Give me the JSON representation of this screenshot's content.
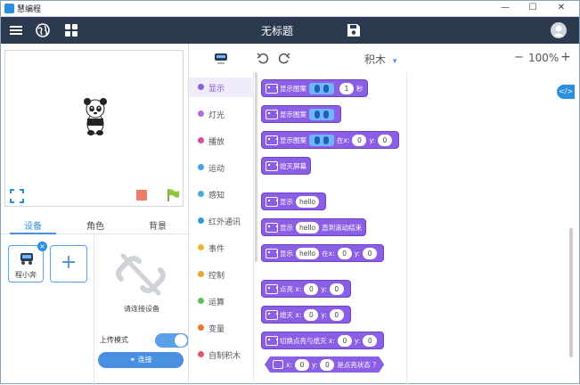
{
  "window": {
    "title": "慧编程",
    "minimize": "—",
    "maximize": "☐",
    "close": "✕"
  },
  "topbar": {
    "doc_title": "无标题"
  },
  "editor": {
    "category_title": "积木",
    "zoom": "100%",
    "zoom_minus": "−",
    "zoom_plus": "+",
    "code_toggle": "</>"
  },
  "tabs": [
    "设备",
    "角色",
    "背景"
  ],
  "device": {
    "name": "程小奔",
    "add": "+",
    "close": "×",
    "hint": "请连接设备",
    "upload_mode": "上传模式",
    "connect": "连接"
  },
  "categories": [
    {
      "label": "显示",
      "color": "#8b5ee6"
    },
    {
      "label": "灯光",
      "color": "#b46be0"
    },
    {
      "label": "播放",
      "color": "#d24fa3"
    },
    {
      "label": "运动",
      "color": "#3fa3e6"
    },
    {
      "label": "感知",
      "color": "#3fb1d9"
    },
    {
      "label": "红外通讯",
      "color": "#2c9ed4"
    },
    {
      "label": "事件",
      "color": "#e9b830"
    },
    {
      "label": "控制",
      "color": "#e9a52b"
    },
    {
      "label": "运算",
      "color": "#59c059"
    },
    {
      "label": "变量",
      "color": "#f0762b"
    },
    {
      "label": "自制积木",
      "color": "#e0566b"
    }
  ],
  "blocks": {
    "b1": {
      "text": "显示图案",
      "v": "1",
      "suffix": "秒"
    },
    "b2": {
      "text": "显示图案"
    },
    "b3": {
      "text": "显示图案",
      "at_x": "在x:",
      "x": "0",
      "y_label": "y:",
      "y": "0"
    },
    "b4": {
      "text": "熄灭屏幕"
    },
    "b5": {
      "text": "显示",
      "v": "hello"
    },
    "b6": {
      "text": "显示",
      "v": "hello",
      "suffix": "直到滚动结束"
    },
    "b7": {
      "text": "显示",
      "v": "hello",
      "at_x": "在x:",
      "x": "0",
      "y_label": "y:",
      "y": "0"
    },
    "b8": {
      "text": "点亮 x:",
      "x": "0",
      "y_label": "y:",
      "y": "0"
    },
    "b9": {
      "text": "熄灭 x:",
      "x": "0",
      "y_label": "y:",
      "y": "0"
    },
    "b10": {
      "text": "切换点亮与熄灭 x:",
      "x": "0",
      "y_label": "y:",
      "y": "0"
    },
    "b11": {
      "text": "x:",
      "x": "0",
      "y_label": "y:",
      "y": "0",
      "suffix": "是点亮状态 ?"
    }
  }
}
